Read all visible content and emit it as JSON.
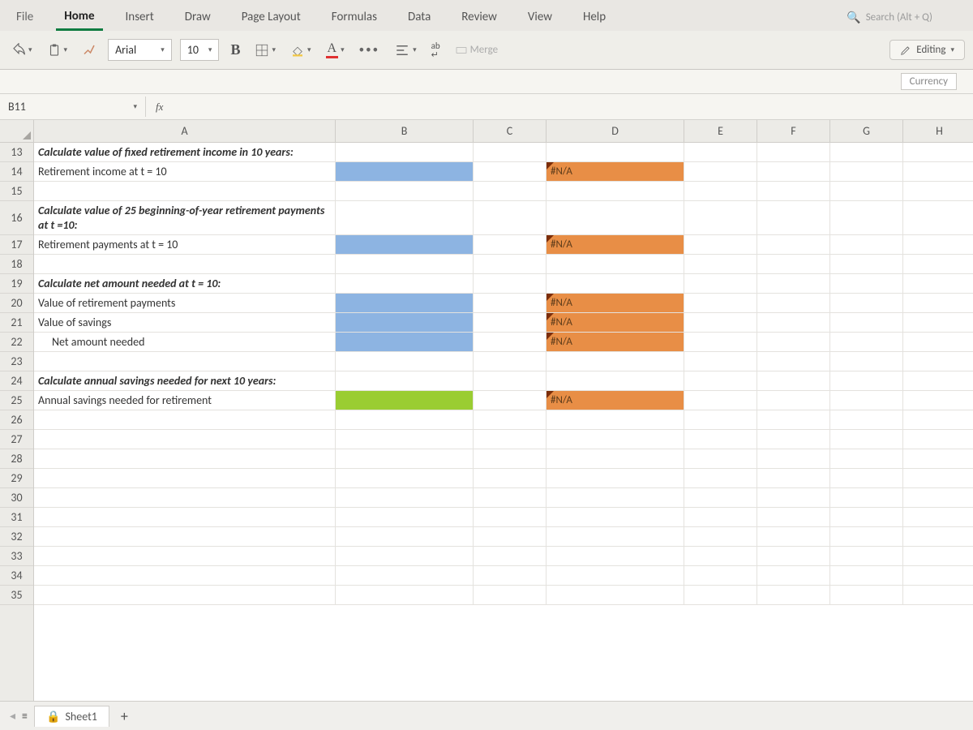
{
  "ribbon": {
    "tabs": [
      "File",
      "Home",
      "Insert",
      "Draw",
      "Page Layout",
      "Formulas",
      "Data",
      "Review",
      "View",
      "Help"
    ],
    "active": "Home",
    "search_placeholder": "Search (Alt + Q)",
    "editing_label": "Editing"
  },
  "toolbar": {
    "font_name": "Arial",
    "font_size": "10",
    "bold": "B",
    "merge_label": "Merge",
    "currency_label": "Currency"
  },
  "namebox": "B11",
  "fx_label": "fx",
  "columns": [
    "A",
    "B",
    "C",
    "D",
    "E",
    "F",
    "G",
    "H"
  ],
  "row_start": 13,
  "row_end": 35,
  "cells": {
    "A13": {
      "text": "Calculate value of fixed retirement income in 10 years:",
      "style": "bold-ital"
    },
    "A14": {
      "text": "Retirement income at t = 10"
    },
    "B14": {
      "fill": "blue"
    },
    "D14": {
      "text": "#N/A",
      "fill": "orange",
      "flag": true
    },
    "A16": {
      "text": "Calculate value of 25 beginning-of-year retirement payments at t =10:",
      "style": "bold-ital",
      "wrap2": true
    },
    "A17": {
      "text": "Retirement payments at t = 10"
    },
    "B17": {
      "fill": "blue"
    },
    "D17": {
      "text": "#N/A",
      "fill": "orange",
      "flag": true
    },
    "A19": {
      "text": "Calculate net amount needed at t = 10:",
      "style": "bold-ital"
    },
    "A20": {
      "text": "Value of retirement payments"
    },
    "B20": {
      "fill": "blue"
    },
    "D20": {
      "text": "#N/A",
      "fill": "orange",
      "flag": true
    },
    "A21": {
      "text": "Value of savings"
    },
    "B21": {
      "fill": "blue"
    },
    "D21": {
      "text": "#N/A",
      "fill": "orange",
      "flag": true
    },
    "A22": {
      "text": "Net amount needed",
      "indent": true
    },
    "B22": {
      "fill": "blue"
    },
    "D22": {
      "text": "#N/A",
      "fill": "orange",
      "flag": true
    },
    "A24": {
      "text": "Calculate annual savings needed for next 10 years:",
      "style": "bold-ital"
    },
    "A25": {
      "text": "Annual savings needed for retirement"
    },
    "B25": {
      "fill": "green"
    },
    "D25": {
      "text": "#N/A",
      "fill": "orange",
      "flag": true
    }
  },
  "sheet": {
    "name": "Sheet1",
    "add": "+"
  }
}
